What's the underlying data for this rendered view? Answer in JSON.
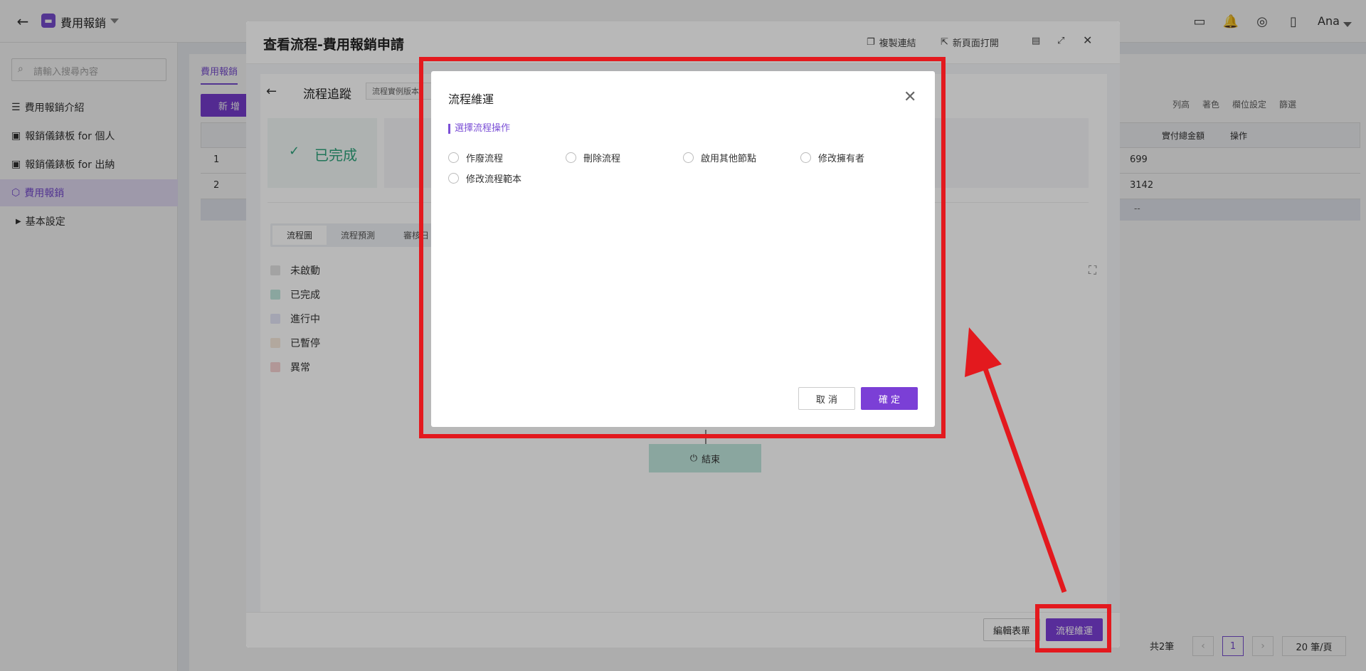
{
  "topbar": {
    "back_icon": "arrow-left-icon",
    "app_icon": "folder-icon",
    "title": "費用報銷",
    "user": "Ana"
  },
  "sidebar": {
    "search_placeholder": "請輸入搜尋內容",
    "items": [
      {
        "label": "費用報銷介紹",
        "icon": "doc-icon"
      },
      {
        "label": "報銷儀錶板 for 個人",
        "icon": "dashboard-icon"
      },
      {
        "label": "報銷儀錶板 for 出納",
        "icon": "dashboard-icon"
      },
      {
        "label": "費用報銷",
        "icon": "cube-icon",
        "active": true
      },
      {
        "label": "基本設定",
        "icon": "caret-right-icon"
      }
    ]
  },
  "main": {
    "tab": "費用報銷",
    "add_button": "新 增",
    "toolbar": [
      "列高",
      "著色",
      "欄位設定",
      "篩選"
    ],
    "columns": [
      "實付總金額",
      "操作"
    ],
    "rows": [
      {
        "index": "1",
        "amount": "699"
      },
      {
        "index": "2",
        "amount": "3142"
      }
    ],
    "footer_select": "--",
    "total": "共2筆",
    "page": "1",
    "page_size": "20 筆/頁"
  },
  "panel": {
    "title": "查看流程-費用報銷申請",
    "actions": {
      "copy_link": "複製連結",
      "new_page": "新頁面打開"
    },
    "tracking_title": "流程追蹤",
    "version_tag": "流程實例版本：",
    "status": "已完成",
    "tabs": [
      "流程圖",
      "流程預測",
      "審核日"
    ],
    "legend": [
      {
        "label": "未啟動",
        "color": "#e2e2e2"
      },
      {
        "label": "已完成",
        "color": "#bfe7dd"
      },
      {
        "label": "進行中",
        "color": "#e3e5f7"
      },
      {
        "label": "已暫停",
        "color": "#f7e9dc"
      },
      {
        "label": "異常",
        "color": "#f5d2d2"
      }
    ],
    "end_node": "結束",
    "footer": {
      "edit_form": "編輯表單",
      "ops": "流程維運"
    }
  },
  "dialog": {
    "title": "流程維運",
    "section": "選擇流程操作",
    "options": [
      "作廢流程",
      "刪除流程",
      "啟用其他節點",
      "修改擁有者",
      "修改流程範本"
    ],
    "cancel": "取 消",
    "confirm": "確 定"
  },
  "colors": {
    "accent": "#7b3fd6",
    "annotation": "#e3191e"
  }
}
